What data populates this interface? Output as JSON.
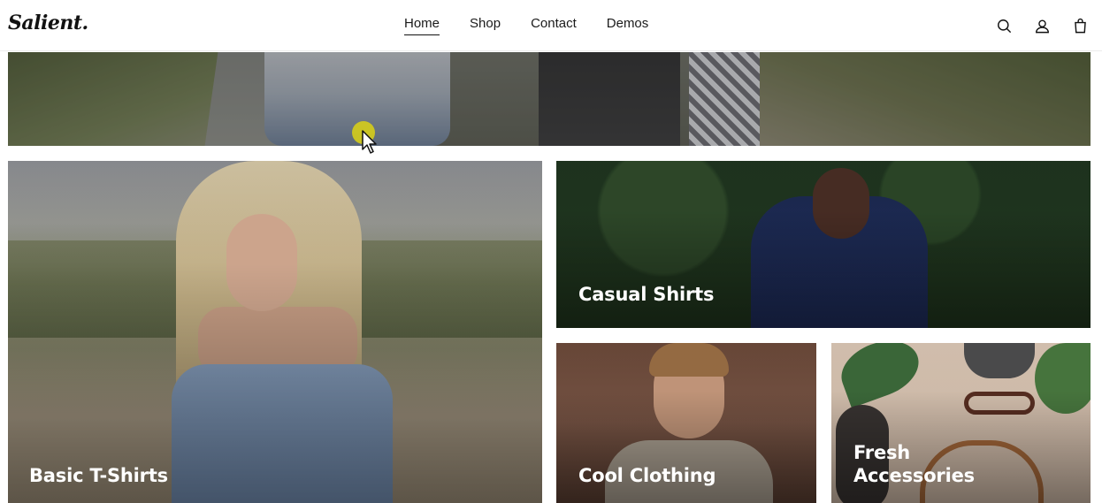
{
  "header": {
    "logo": "Salient.",
    "nav": [
      {
        "label": "Home",
        "active": true
      },
      {
        "label": "Shop",
        "active": false
      },
      {
        "label": "Contact",
        "active": false
      },
      {
        "label": "Demos",
        "active": false
      }
    ],
    "icons": [
      "search-icon",
      "user-icon",
      "shopping-bag-icon"
    ]
  },
  "cards": {
    "basic": {
      "label": "Basic T-Shirts"
    },
    "casual": {
      "label": "Casual Shirts"
    },
    "cool": {
      "label": "Cool Clothing"
    },
    "fresh": {
      "label": "Fresh Accessories"
    }
  },
  "colors": {
    "text": "#111111",
    "card_label": "#ffffff",
    "cursor_highlight": "#dcd214"
  }
}
